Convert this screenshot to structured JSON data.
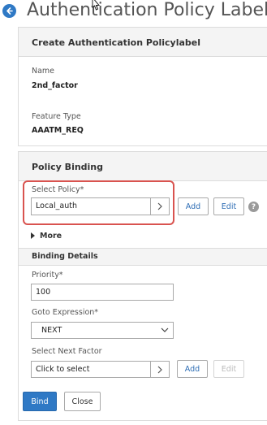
{
  "header": {
    "title": "Authentication Policy Label"
  },
  "create_panel": {
    "heading": "Create Authentication Policylabel",
    "name_label": "Name",
    "name_value": "2nd_factor",
    "feature_label": "Feature Type",
    "feature_value": "AAATM_REQ"
  },
  "binding_panel": {
    "heading": "Policy Binding",
    "select_policy_label": "Select Policy*",
    "select_policy_value": "Local_auth",
    "add_label": "Add",
    "edit_label": "Edit",
    "help_glyph": "?",
    "more_label": "More",
    "details_heading": "Binding Details",
    "priority_label": "Priority*",
    "priority_value": "100",
    "goto_label": "Goto Expression*",
    "goto_value": "NEXT",
    "next_factor_label": "Select Next Factor",
    "next_factor_placeholder": "Click to select",
    "next_add_label": "Add",
    "next_edit_label": "Edit"
  },
  "footer": {
    "bind_label": "Bind",
    "close_label": "Close"
  },
  "colors": {
    "accent": "#2f79c5",
    "highlight": "#d9534f"
  },
  "icons": [
    "back-arrow-icon",
    "chevron-right-icon",
    "chevron-down-icon",
    "triangle-right-icon",
    "help-icon",
    "mouse-cursor-icon"
  ]
}
